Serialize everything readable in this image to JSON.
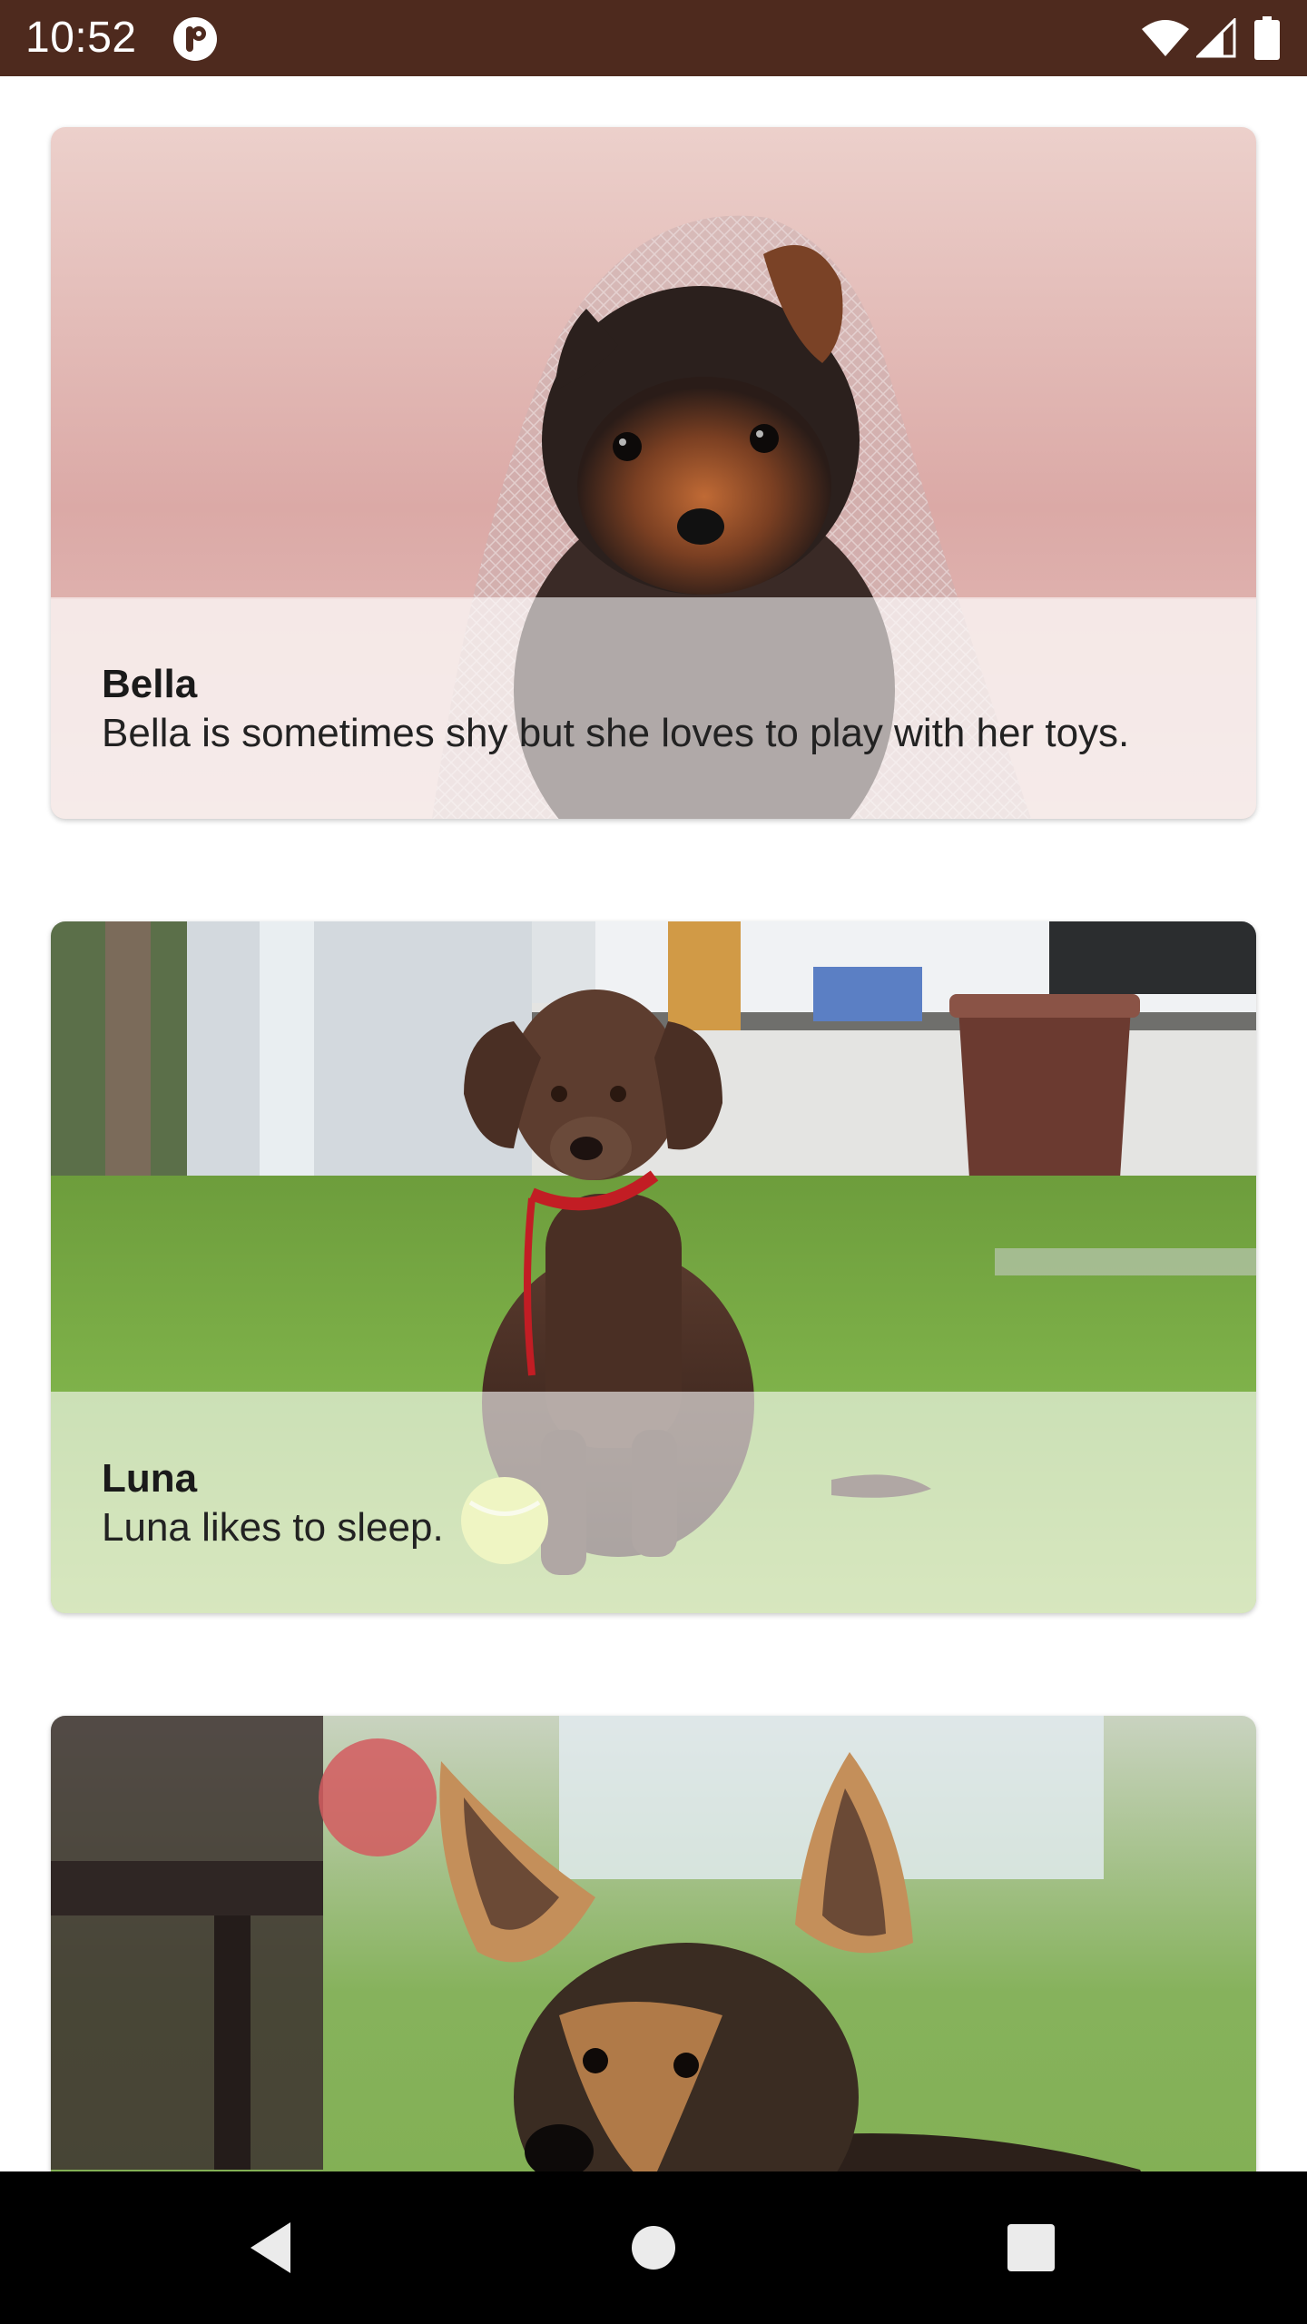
{
  "status_bar": {
    "time": "10:52",
    "background_color": "#4e2a1e",
    "icons": [
      "app-notification-icon",
      "wifi-icon",
      "cell-signal-icon",
      "battery-icon"
    ]
  },
  "puppies": [
    {
      "name": "Bella",
      "description": "Bella is sometimes shy but she loves to play with her toys.",
      "image": "yorkshire-terrier-puppy-photo"
    },
    {
      "name": "Luna",
      "description": "Luna likes to sleep.",
      "image": "chocolate-labrador-puppy-photo"
    },
    {
      "image": "german-shepherd-puppy-photo"
    }
  ],
  "nav_bar": {
    "buttons": [
      "back-icon",
      "home-icon",
      "recents-icon"
    ]
  }
}
